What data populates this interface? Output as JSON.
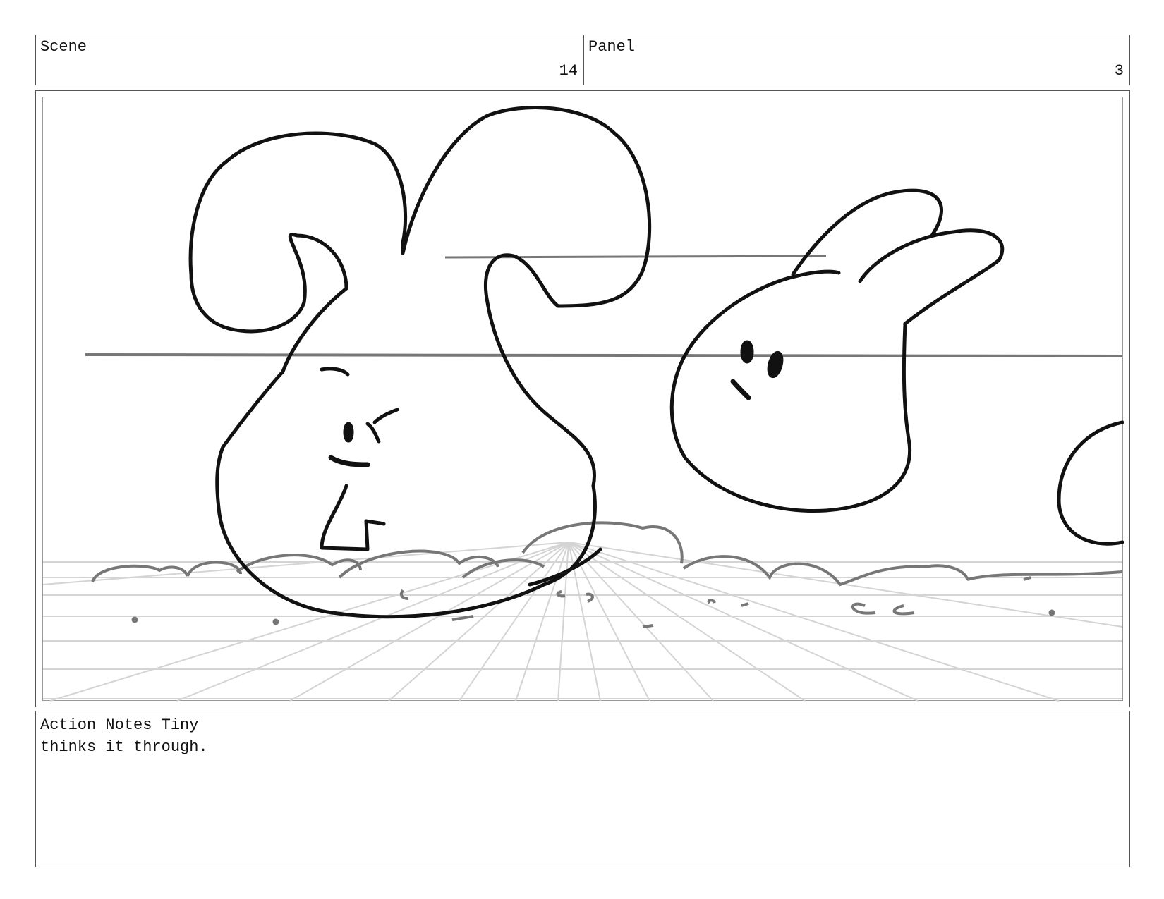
{
  "scene": {
    "label": "Scene",
    "number": "14"
  },
  "panel": {
    "label": "Panel",
    "number": "3"
  },
  "notes": {
    "line1": "Action Notes Tiny",
    "line2": "thinks it through."
  },
  "drawing": {
    "subject": "rough storyboard sketch of two bunny characters on a grid floor",
    "ink_color": "#111111",
    "guide_color": "#cccccc",
    "horizon_color": "#777777",
    "icons": [
      "bunny-big",
      "bunny-small",
      "bunny-partial"
    ]
  }
}
